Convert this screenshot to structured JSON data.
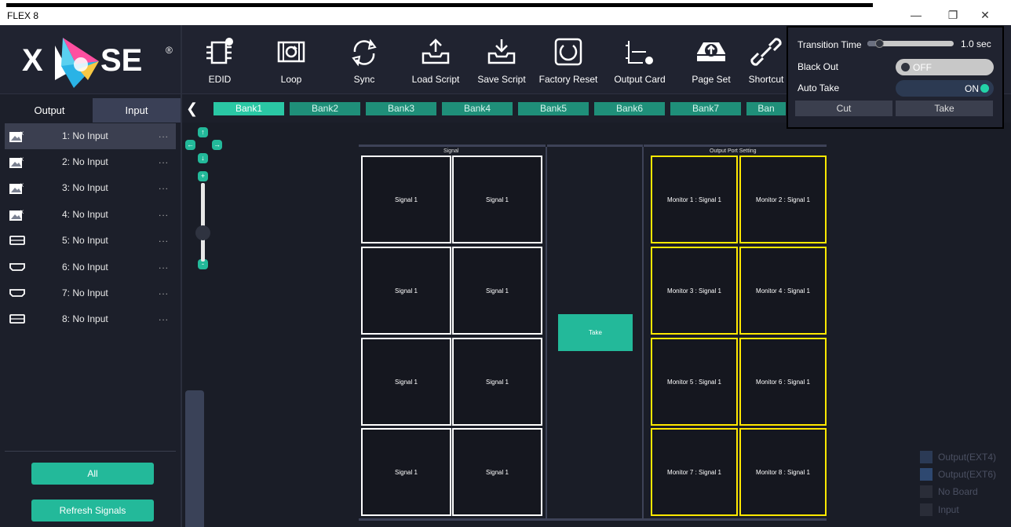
{
  "window": {
    "title": "FLEX 8",
    "minimize_glyph": "—",
    "restore_glyph": "❐",
    "close_glyph": "✕"
  },
  "logo": {
    "text_left": "X",
    "text_right": "SE",
    "brand": "XPOSE",
    "registered": "®"
  },
  "toolbar": [
    {
      "label": "EDID",
      "icon": "edid-chip-icon"
    },
    {
      "label": "Loop",
      "icon": "loop-icon"
    },
    {
      "label": "Sync",
      "icon": "sync-icon"
    },
    {
      "label": "Load Script",
      "icon": "load-script-icon"
    },
    {
      "label": "Save Script",
      "icon": "save-script-icon"
    },
    {
      "label": "Factory Reset",
      "icon": "factory-reset-icon"
    },
    {
      "label": "Output Card",
      "icon": "output-card-icon"
    },
    {
      "label": "Page Set",
      "icon": "page-set-icon"
    },
    {
      "label": "Shortcut",
      "icon": "shortcut-icon"
    }
  ],
  "sidebar": {
    "tabs": {
      "output": "Output",
      "input": "Input",
      "active": "Input"
    },
    "inputs": [
      {
        "label": "1: No Input",
        "more": "...",
        "icon": "no-signal-icon"
      },
      {
        "label": "2: No Input",
        "more": "...",
        "icon": "no-signal-icon"
      },
      {
        "label": "3: No Input",
        "more": "...",
        "icon": "no-signal-icon"
      },
      {
        "label": "4: No Input",
        "more": "...",
        "icon": "no-signal-icon"
      },
      {
        "label": "5: No Input",
        "more": "...",
        "icon": "hdmi-port-icon"
      },
      {
        "label": "6: No Input",
        "more": "...",
        "icon": "hdmi-port-icon"
      },
      {
        "label": "7: No Input",
        "more": "...",
        "icon": "hdmi-port-icon"
      },
      {
        "label": "8: No Input",
        "more": "...",
        "icon": "hdmi-port-icon"
      }
    ],
    "all_button": "All",
    "refresh_button": "Refresh Signals"
  },
  "banks": {
    "back_glyph": "❮",
    "items": [
      "Bank1",
      "Bank2",
      "Bank3",
      "Bank4",
      "Bank5",
      "Bank6",
      "Bank7",
      "Ban"
    ],
    "active": "Bank1"
  },
  "controls": {
    "up": "↑",
    "down": "↓",
    "left": "←",
    "right": "→",
    "zoom_in": "+",
    "zoom_out": "-"
  },
  "signal_panel": {
    "title": "Signal",
    "cells": [
      "Signal 1",
      "Signal 1",
      "Signal 1",
      "Signal 1",
      "Signal 1",
      "Signal 1",
      "Signal 1",
      "Signal 1"
    ]
  },
  "take_button": "Take",
  "output_panel": {
    "title": "Output Port  Setting",
    "cells": [
      "Monitor  1 : Signal 1",
      "Monitor  2 : Signal 1",
      "Monitor  3 : Signal 1",
      "Monitor  4 : Signal 1",
      "Monitor  5 : Signal 1",
      "Monitor  6 : Signal 1",
      "Monitor  7 : Signal 1",
      "Monitor  8 : Signal 1"
    ]
  },
  "popup": {
    "transition_label": "Transition Time",
    "transition_value": "1.0 sec",
    "transition_fraction": 0.1,
    "blackout_label": "Black Out",
    "blackout_state": "OFF",
    "autotake_label": "Auto Take",
    "autotake_state": "ON",
    "cut_button": "Cut",
    "take_button": "Take"
  },
  "legend": [
    {
      "label": "Output(EXT4)",
      "color": "#2b3a55"
    },
    {
      "label": "Output(EXT6)",
      "color": "#2e4870"
    },
    {
      "label": "No Board",
      "color": "#2a2d38"
    },
    {
      "label": "Input",
      "color": "#2a2d38"
    }
  ],
  "colors": {
    "accent": "#23b99a",
    "monitor_border": "#ffe800",
    "signal_border": "#ffffff"
  }
}
